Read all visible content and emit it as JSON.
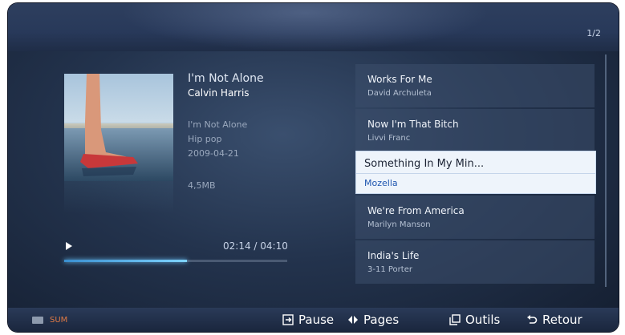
{
  "page_indicator": "1/2",
  "now_playing": {
    "title": "I'm Not Alone",
    "artist": "Calvin Harris",
    "album": "I'm Not Alone",
    "genre": "Hip pop",
    "date": "2009-04-21",
    "size": "4,5MB",
    "time": "02:14 / 04:10",
    "progress": 0.55
  },
  "playlist": [
    {
      "title": "Works For Me",
      "artist": "David Archuleta"
    },
    {
      "title": "Now I'm That Bitch",
      "artist": "Livvi Franc"
    },
    {
      "title": "Something In My Min...",
      "artist": "Mozella"
    },
    {
      "title": "We're From America",
      "artist": "Marilyn Manson"
    },
    {
      "title": "India's Life",
      "artist": "3-11 Porter"
    }
  ],
  "footer": {
    "sum_label": "SUM",
    "pause_label": "Pause",
    "pages_label": "Pages",
    "tools_label": "Outils",
    "back_label": "Retour"
  },
  "colors": {
    "accent": "#3a8fd0",
    "selected_bg": "#eef4fb",
    "sum_text": "#e07a45"
  }
}
